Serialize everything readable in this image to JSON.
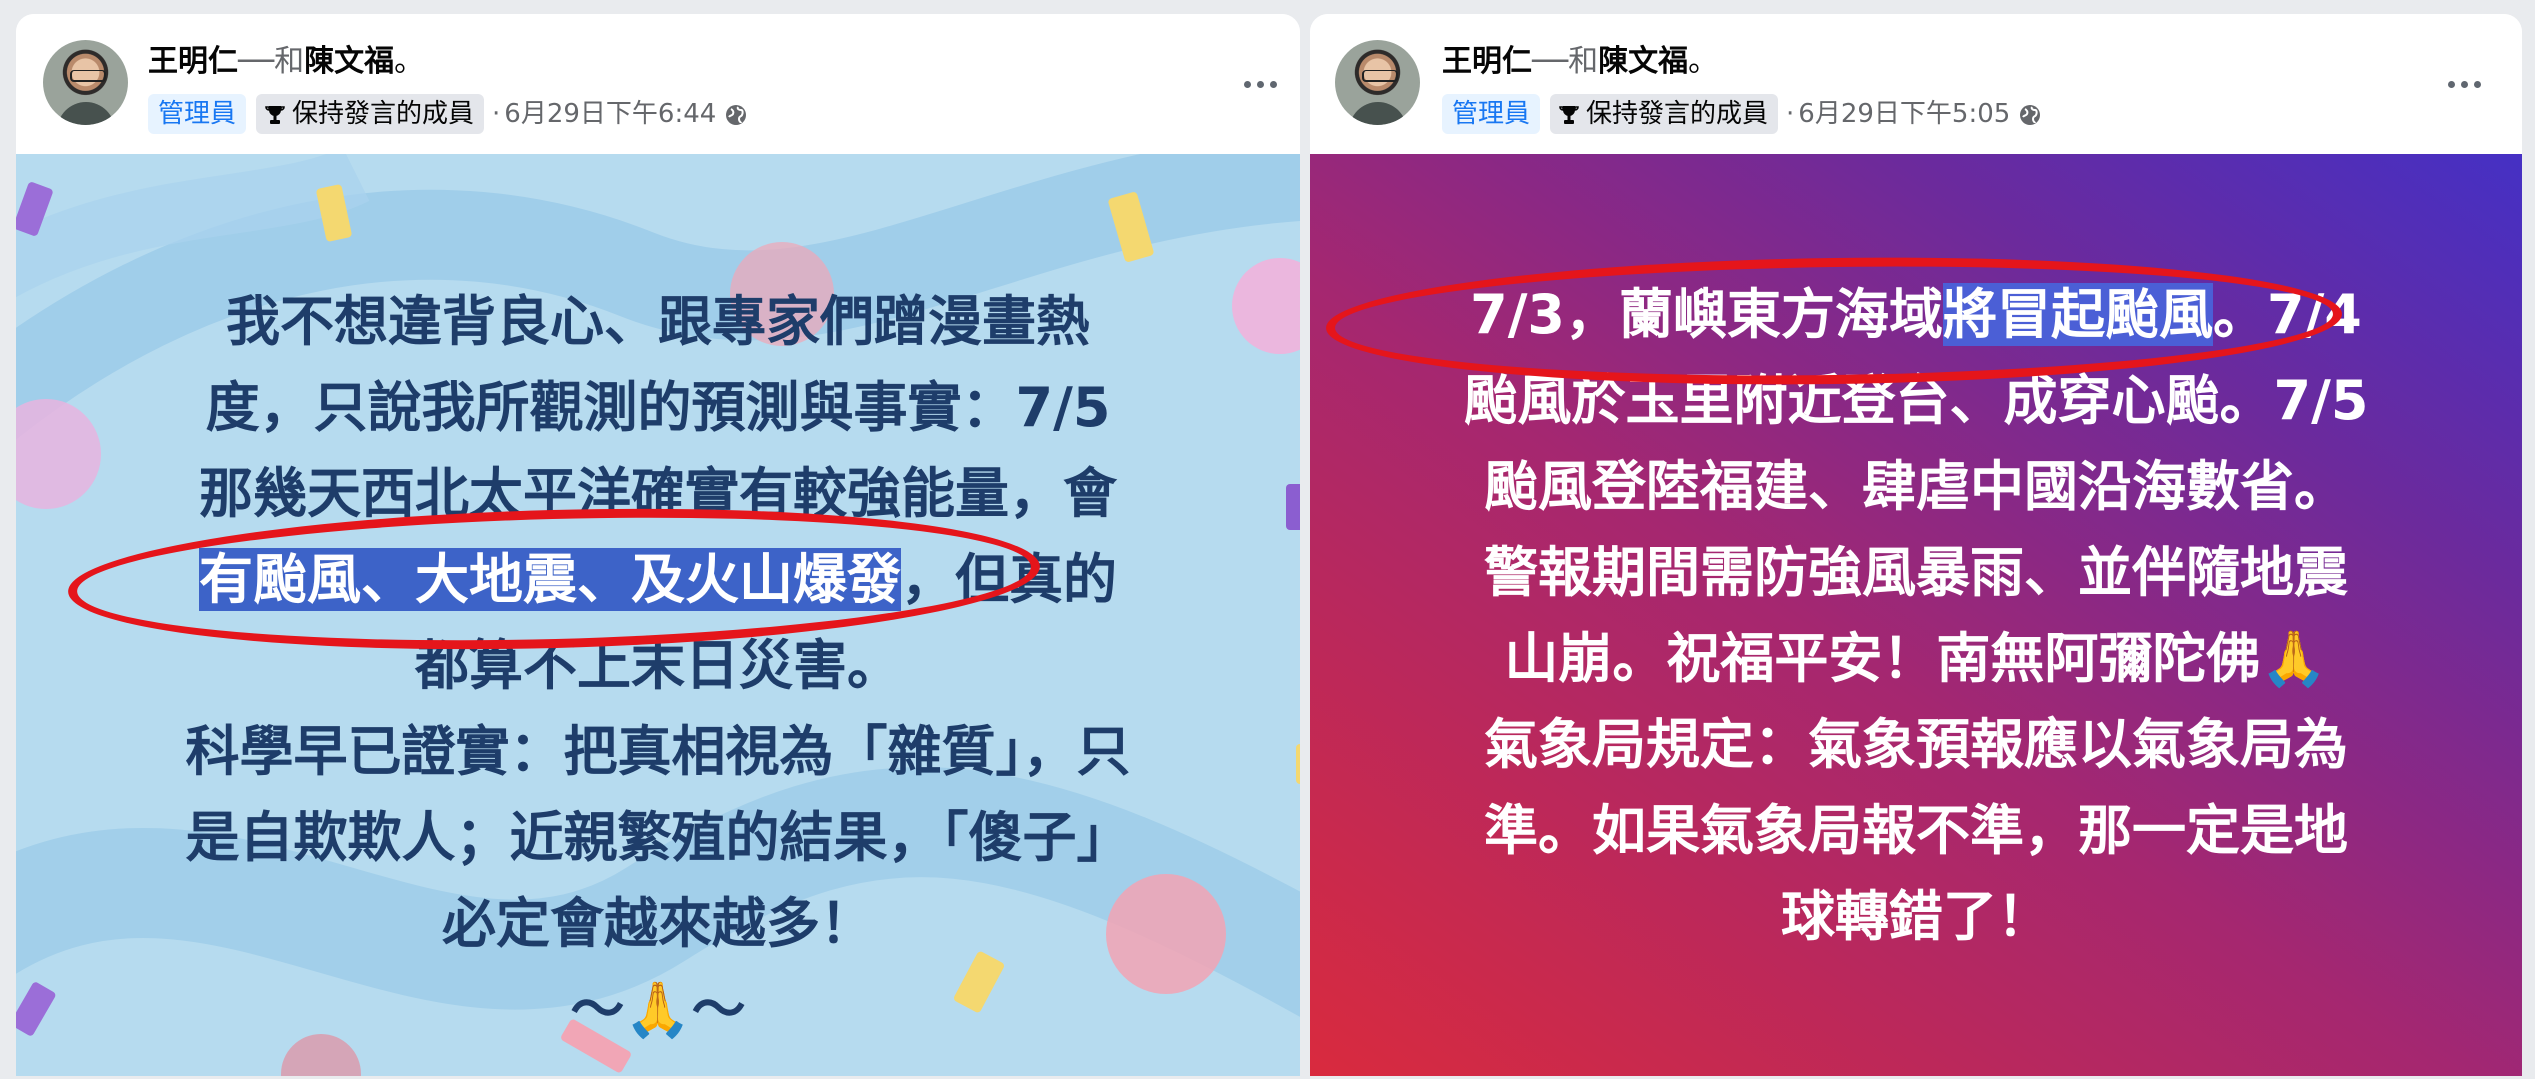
{
  "posts": [
    {
      "author": "王明仁",
      "connector": "──和",
      "tagged": "陳文福",
      "suffix": "。",
      "badges": [
        "管理員",
        "保持發言的成員"
      ],
      "timestamp": "6月29日下午6:44",
      "separator": "·",
      "privacy_icon": "globe-icon",
      "text_lines": [
        {
          "before": "我不想違背良心、跟專家們蹭漫畫熱",
          "highlight": "",
          "after": ""
        },
        {
          "before": "度，只說我所觀測的預測與事實：7/5",
          "highlight": "",
          "after": ""
        },
        {
          "before": "那幾天西北太平洋確實有較強能量，會",
          "highlight": "",
          "after": ""
        },
        {
          "before": "",
          "highlight": "有颱風、大地震、及火山爆發",
          "after": "，但真的"
        },
        {
          "before": "都算不上末日災害。",
          "highlight": "",
          "after": ""
        },
        {
          "before": "科學早已證實：把真相視為「雜質」，只",
          "highlight": "",
          "after": ""
        },
        {
          "before": "是自欺欺人；近親繁殖的結果，「傻子」",
          "highlight": "",
          "after": ""
        },
        {
          "before": "必定會越來越多！",
          "highlight": "",
          "after": ""
        },
        {
          "before": "～🙏～",
          "highlight": "",
          "after": ""
        }
      ]
    },
    {
      "author": "王明仁",
      "connector": "──和",
      "tagged": "陳文福",
      "suffix": "。",
      "badges": [
        "管理員",
        "保持發言的成員"
      ],
      "timestamp": "6月29日下午5:05",
      "separator": "·",
      "privacy_icon": "globe-icon",
      "text_lines": [
        {
          "before": "7/3，蘭嶼東方海域",
          "highlight": "將冒起颱風",
          "after": "。7/4"
        },
        {
          "before": "颱風於玉里附近登台、成穿心颱。7/5",
          "highlight": "",
          "after": ""
        },
        {
          "before": "颱風登陸福建、肆虐中國沿海數省。",
          "highlight": "",
          "after": ""
        },
        {
          "before": "警報期間需防強風暴雨、並伴隨地震",
          "highlight": "",
          "after": ""
        },
        {
          "before": "山崩。祝福平安！南無阿彌陀佛🙏",
          "highlight": "",
          "after": ""
        },
        {
          "before": "氣象局規定：氣象預報應以氣象局為",
          "highlight": "",
          "after": ""
        },
        {
          "before": "準。如果氣象局報不準，那一定是地",
          "highlight": "",
          "after": ""
        },
        {
          "before": "球轉錯了！",
          "highlight": "",
          "after": ""
        }
      ]
    }
  ],
  "colors": {
    "left_background": "#b6dbef",
    "left_text": "#1e3d6a",
    "right_background_start": "#d92a3e",
    "right_background_end": "#4530c4",
    "highlight": "#3d63c8",
    "annotation_oval": "#e5151b",
    "admin_badge_text": "#1877f2"
  }
}
